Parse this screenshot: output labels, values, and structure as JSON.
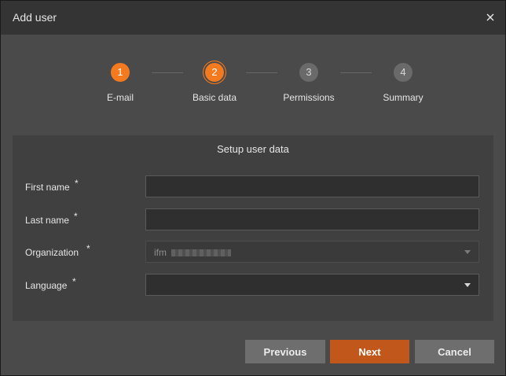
{
  "window": {
    "title": "Add user",
    "close_icon": "close-icon"
  },
  "stepper": {
    "steps": [
      {
        "number": "1",
        "label": "E-mail",
        "state": "done"
      },
      {
        "number": "2",
        "label": "Basic data",
        "state": "active"
      },
      {
        "number": "3",
        "label": "Permissions",
        "state": "pending"
      },
      {
        "number": "4",
        "label": "Summary",
        "state": "pending"
      }
    ]
  },
  "form": {
    "title": "Setup user data",
    "required_marker": "*",
    "fields": {
      "first_name": {
        "label": "First name",
        "value": ""
      },
      "last_name": {
        "label": "Last name",
        "value": ""
      },
      "organization": {
        "label": "Organization",
        "value": "ifm",
        "disabled": true
      },
      "language": {
        "label": "Language",
        "value": ""
      }
    }
  },
  "footer": {
    "previous_label": "Previous",
    "next_label": "Next",
    "cancel_label": "Cancel"
  },
  "colors": {
    "accent": "#f47a1f",
    "primary_button": "#c1571b",
    "background": "#4a4a4a",
    "titlebar": "#343434",
    "panel": "#404040"
  }
}
